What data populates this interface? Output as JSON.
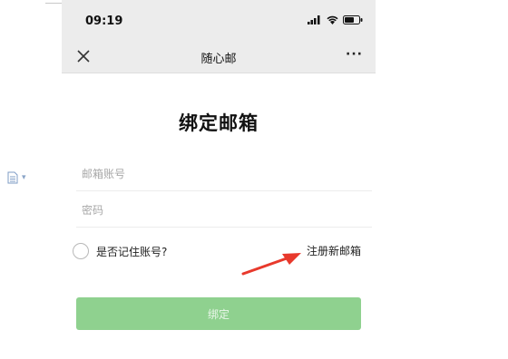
{
  "status_bar": {
    "time": "09:19"
  },
  "navbar": {
    "title": "随心邮",
    "close_icon": "close-icon",
    "more_label": "···"
  },
  "form": {
    "heading": "绑定邮箱",
    "email_placeholder": "邮箱账号",
    "password_placeholder": "密码",
    "remember_label": "是否记住账号?",
    "register_link": "注册新邮箱",
    "submit_label": "绑定"
  },
  "colors": {
    "submit_button": "#8fd18f",
    "annotation_arrow": "#e8392c",
    "bar_background": "#ececec"
  }
}
